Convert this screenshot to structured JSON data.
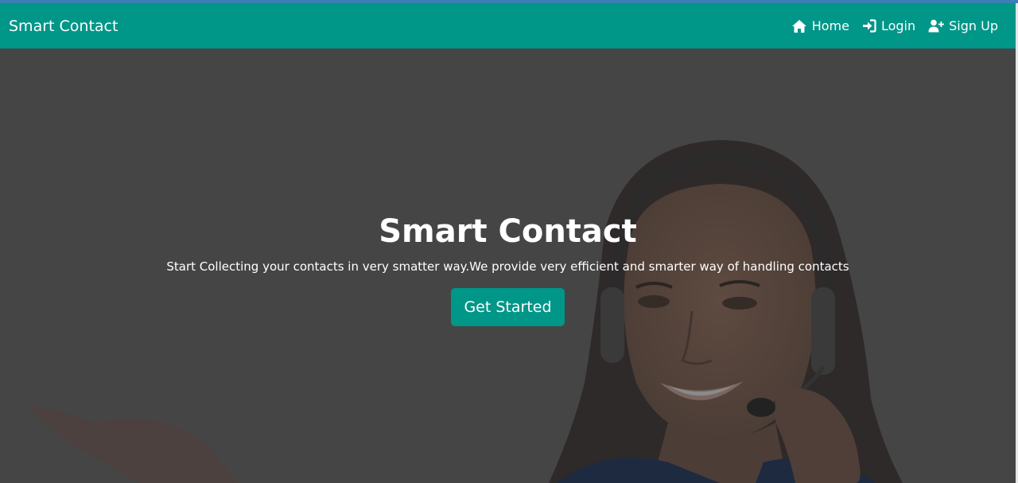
{
  "navbar": {
    "brand": "Smart Contact",
    "links": [
      {
        "label": "Home",
        "icon": "home-icon"
      },
      {
        "label": "Login",
        "icon": "login-icon"
      },
      {
        "label": "Sign Up",
        "icon": "user-plus-icon"
      }
    ],
    "background_color": "#009688"
  },
  "hero": {
    "title": "Smart Contact",
    "subtitle": "Start Collecting your contacts in very smatter way.We provide very efficient and smarter way of handling contacts",
    "cta_label": "Get Started",
    "image": "customer-support-agent-with-headset"
  }
}
